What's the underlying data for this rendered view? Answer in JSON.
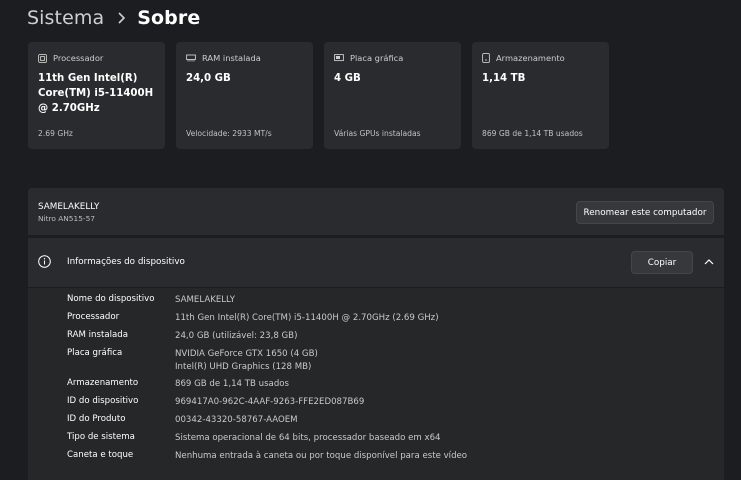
{
  "breadcrumb": {
    "parent": "Sistema",
    "current": "Sobre"
  },
  "cards": [
    {
      "icon": "processor-icon",
      "label": "Processador",
      "value": "11th Gen Intel(R) Core(TM) i5-11400H @ 2.70GHz",
      "sub": "2.69 GHz"
    },
    {
      "icon": "ram-icon",
      "label": "RAM instalada",
      "value": "24,0 GB",
      "sub": "Velocidade: 2933 MT/s"
    },
    {
      "icon": "gpu-icon",
      "label": "Placa gráfica",
      "value": "4 GB",
      "sub": "Várias GPUs instaladas"
    },
    {
      "icon": "storage-icon",
      "label": "Armazenamento",
      "value": "1,14 TB",
      "sub": "869 GB de 1,14 TB usados"
    }
  ],
  "computer": {
    "name": "SAMELAKELLY",
    "model": "Nitro AN515-57",
    "rename_label": "Renomear este computador"
  },
  "device_info": {
    "title": "Informações do dispositivo",
    "copy_label": "Copiar",
    "rows": [
      {
        "label": "Nome do dispositivo",
        "value": "SAMELAKELLY"
      },
      {
        "label": "Processador",
        "value": "11th Gen Intel(R) Core(TM) i5-11400H @ 2.70GHz (2.69 GHz)"
      },
      {
        "label": "RAM instalada",
        "value": "24,0 GB (utilizável: 23,8 GB)"
      },
      {
        "label": "Placa gráfica",
        "value": "NVIDIA GeForce GTX 1650 (4 GB)",
        "value2": "Intel(R) UHD Graphics (128 MB)"
      },
      {
        "label": "Armazenamento",
        "value": "869 GB de 1,14 TB usados"
      },
      {
        "label": "ID do dispositivo",
        "value": "969417A0-962C-4AAF-9263-FFE2ED087B69"
      },
      {
        "label": "ID do Produto",
        "value": "00342-43320-58767-AAOEM"
      },
      {
        "label": "Tipo de sistema",
        "value": "Sistema operacional de 64 bits, processador baseado em x64"
      },
      {
        "label": "Caneta e toque",
        "value": "Nenhuma entrada à caneta ou por toque disponível para este vídeo"
      }
    ]
  }
}
